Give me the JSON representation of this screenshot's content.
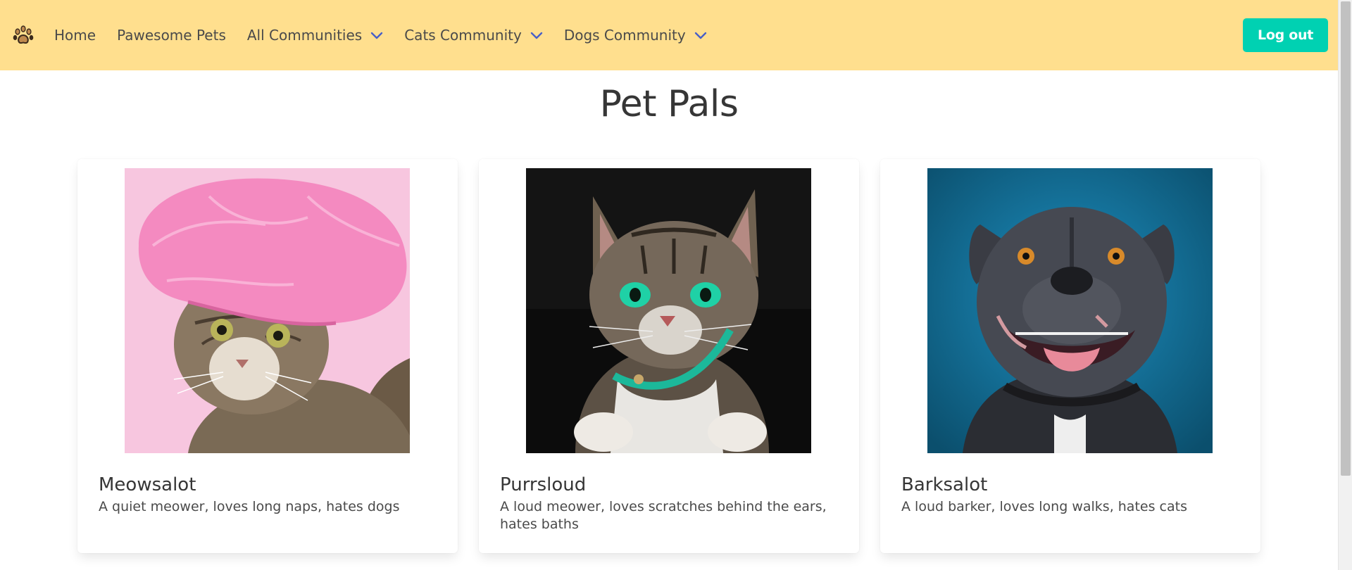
{
  "nav": {
    "brand_icon": "paw-print-icon",
    "links": [
      {
        "label": "Home"
      },
      {
        "label": "Pawesome Pets"
      },
      {
        "label": "All Communities",
        "icon": "chevron-down-icon"
      },
      {
        "label": "Cats Community",
        "icon": "chevron-down-icon"
      },
      {
        "label": "Dogs Community",
        "icon": "chevron-down-icon"
      }
    ],
    "logout_label": "Log out"
  },
  "page": {
    "title": "Pet Pals"
  },
  "pets": [
    {
      "name": "Meowsalot",
      "description": "A quiet meower, loves long naps, hates dogs"
    },
    {
      "name": "Purrsloud",
      "description": "A loud meower, loves scratches behind the ears, hates baths"
    },
    {
      "name": "Barksalot",
      "description": "A loud barker, loves long walks, hates cats"
    }
  ],
  "colors": {
    "navbar_bg": "#ffdf8e",
    "logout_bg": "#00d1b2",
    "chevron": "#485fc7"
  }
}
